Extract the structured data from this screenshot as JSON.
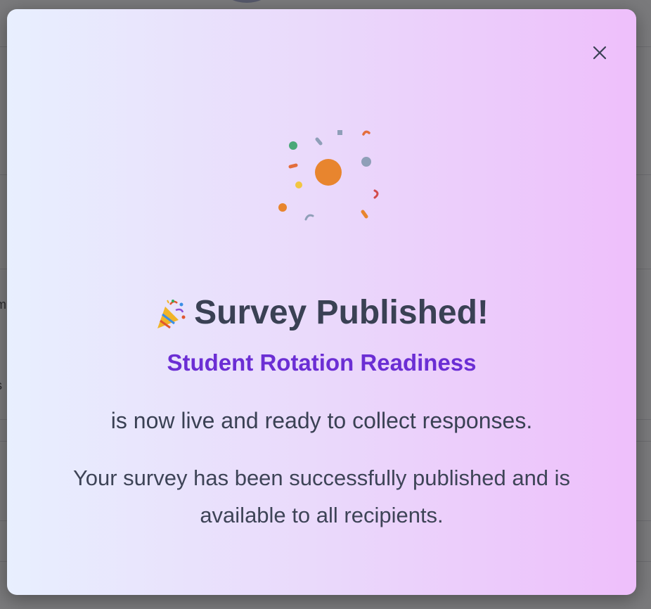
{
  "background": {
    "partial_text": [
      "m",
      "s"
    ]
  },
  "modal": {
    "close_label": "×",
    "confetti_icon": "confetti-burst-icon",
    "party_icon": "party-popper-icon",
    "title": "Survey Published!",
    "survey_name": "Student Rotation Readiness",
    "status_line": "is now live and ready to collect responses.",
    "description": "Your survey has been successfully published and is available to all recipients."
  },
  "colors": {
    "accent": "#6b2ed4",
    "text": "#3a4154",
    "gradient_start": "#e8effe",
    "gradient_end": "#eebffb"
  }
}
